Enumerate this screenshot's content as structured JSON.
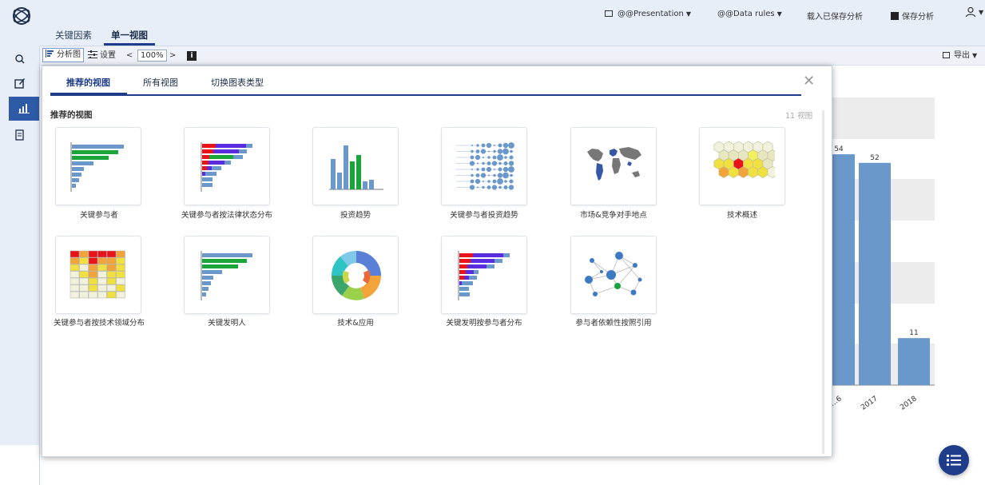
{
  "header": {
    "presentation_menu": "@@Presentation",
    "data_rules_menu": "@@Data rules",
    "load_saved": "载入已保存分析",
    "save_analysis": "保存分析",
    "tabs": [
      {
        "label": "关键因素"
      },
      {
        "label": "单一视图"
      }
    ]
  },
  "toolbar": {
    "analysis_label": "分析图",
    "settings_label": "设置",
    "zoom_value": "100%",
    "export_label": "导出"
  },
  "modal": {
    "tabs": [
      {
        "label": "推荐的视图"
      },
      {
        "label": "所有视图"
      },
      {
        "label": "切换图表类型"
      }
    ],
    "section_title": "推荐的视图",
    "view_count": "11 视图",
    "cards": [
      {
        "label": "关键参与者",
        "icon": "bar-chart-horizontal-icon"
      },
      {
        "label": "关键参与者按法律状态分布",
        "icon": "stacked-bar-icon"
      },
      {
        "label": "投资趋势",
        "icon": "column-chart-icon"
      },
      {
        "label": "关键参与者投资趋势",
        "icon": "bubble-grid-icon"
      },
      {
        "label": "市场&竞争对手地点",
        "icon": "world-map-icon"
      },
      {
        "label": "技术概述",
        "icon": "hexagon-map-icon"
      },
      {
        "label": "关键参与者按技术领域分布",
        "icon": "heatmap-icon"
      },
      {
        "label": "关键发明人",
        "icon": "bar-chart-horizontal-icon"
      },
      {
        "label": "技术&应用",
        "icon": "sunburst-icon"
      },
      {
        "label": "关键发明按参与者分布",
        "icon": "stacked-bar-icon"
      },
      {
        "label": "参与者依赖性按照引用",
        "icon": "network-graph-icon"
      }
    ]
  },
  "background_chart": {
    "bars": [
      {
        "year": "…6",
        "value": 54
      },
      {
        "year": "2017",
        "value": 52
      },
      {
        "year": "2018",
        "value": 11
      }
    ],
    "bar_color": "#6b98cb"
  },
  "colors": {
    "accent": "#1f3c8a",
    "header_bg": "#e8eef7"
  }
}
